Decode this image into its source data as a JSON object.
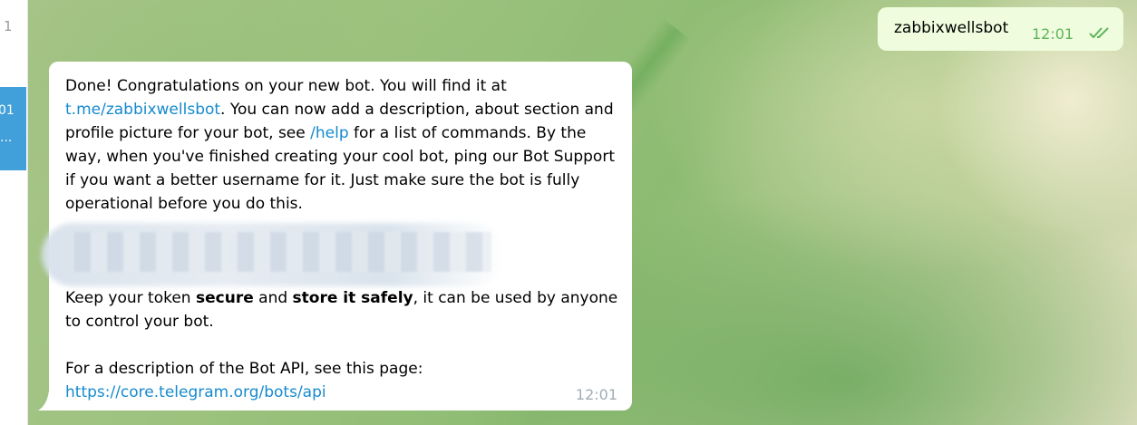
{
  "sidebar": {
    "count": "1",
    "active_time": "01",
    "active_dots": "..."
  },
  "outgoing": {
    "text": "zabbixwellsbot",
    "time": "12:01",
    "status_icon": "double-check-icon",
    "time_color": "#5fb45b",
    "bubble_color": "#effdde"
  },
  "incoming": {
    "p1_a": "Done! Congratulations on your new bot. You will find it at ",
    "p1_link": "t.me/zabbixwellsbot",
    "p1_b": ". You can now add a description, about section and profile picture for your bot, see ",
    "p1_help": "/help",
    "p1_c": " for a list of commands. By the way, when you've finished creating your cool bot, ping our Bot Support if you want a better username for it. Just make sure the bot is fully operational before you do this.",
    "p2_a": "Keep your token ",
    "p2_b1": "secure",
    "p2_c": " and ",
    "p2_b2": "store it safely",
    "p2_d": ", it can be used by anyone to control your bot.",
    "p3_a": "For a description of the Bot API, see this page:",
    "p3_link": "https://core.telegram.org/bots/api",
    "time": "12:01",
    "link_color": "#168acd"
  }
}
